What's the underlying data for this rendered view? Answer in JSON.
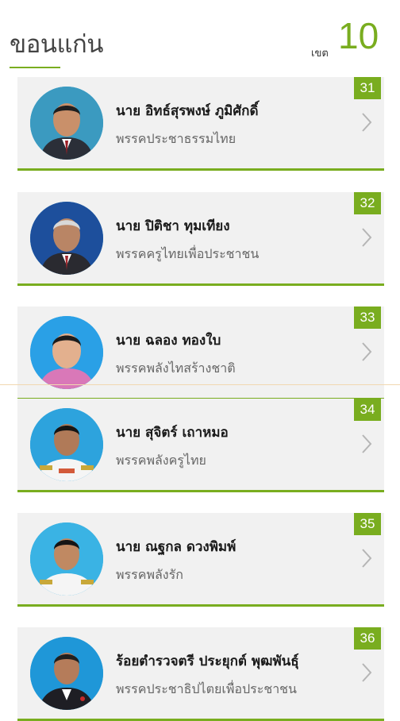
{
  "header": {
    "province": "ขอนแก่น",
    "district_label": "เขต",
    "district_number": "10"
  },
  "accent_color": "#79ad1f",
  "candidates": [
    {
      "number": "31",
      "name": "นาย อิทธ์สุรพงษ์ ภูมิศักดิ์",
      "party": "พรรคประชาธรรมไทย",
      "photo_bg": "#3b9ac0"
    },
    {
      "number": "32",
      "name": "นาย ปิติชา ทุมเทียง",
      "party": "พรรคครูไทยเพื่อประชาชน",
      "photo_bg": "#1d4f9c"
    },
    {
      "number": "33",
      "name": "นาย ฉลอง ทองใบ",
      "party": "พรรคพลังไทสร้างชาติ",
      "photo_bg": "#2aa0e6"
    },
    {
      "number": "34",
      "name": "นาย สุจิตร์ เถาหมอ",
      "party": "พรรคพลังครูไทย",
      "photo_bg": "#2da3dd"
    },
    {
      "number": "35",
      "name": "นาย ณฐกล ดวงพิมพ์",
      "party": "พรรคพลังรัก",
      "photo_bg": "#3ab3e4"
    },
    {
      "number": "36",
      "name": "ร้อยตำรวจตรี ประยุกต์ พุฒพันธุ์",
      "party": "พรรคประชาธิปไตยเพื่อประชาชน",
      "photo_bg": "#1f97d8"
    }
  ]
}
